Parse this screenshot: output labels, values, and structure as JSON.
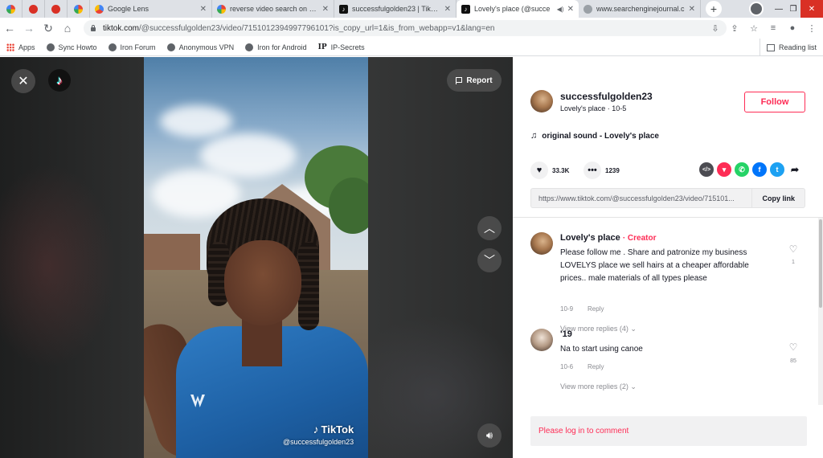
{
  "browser": {
    "tabs": [
      {
        "title": "",
        "icon": "google-icon"
      },
      {
        "title": "",
        "icon": "red-circle-icon"
      },
      {
        "title": "",
        "icon": "red-circle-icon"
      },
      {
        "title": "",
        "icon": "google-icon"
      },
      {
        "title": "Google Lens",
        "icon": "google-lens-icon"
      },
      {
        "title": "reverse video search on goo",
        "icon": "google-icon"
      },
      {
        "title": "successfulgolden23 | TikTok",
        "icon": "tiktok-icon"
      },
      {
        "title": "Lovely's place (@succe",
        "icon": "tiktok-icon",
        "active": true
      },
      {
        "title": "www.searchenginejournal.c",
        "icon": "globe-icon"
      }
    ],
    "url_host": "tiktok.com",
    "url_path": "/@successfulgolden23/video/7151012394997796101?is_copy_url=1&is_from_webapp=v1&lang=en",
    "bookmarks": [
      "Apps",
      "Sync Howto",
      "Iron Forum",
      "Anonymous VPN",
      "Iron for Android",
      "IP-Secrets"
    ],
    "reading_list": "Reading list"
  },
  "video": {
    "report_label": "Report",
    "watermark_brand": "TikTok",
    "watermark_user": "@successfulgolden23"
  },
  "post": {
    "author_name": "successfulgolden23",
    "author_sub": "Lovely's place · 10-5",
    "follow_label": "Follow",
    "sound": "original sound - Lovely's place",
    "likes": "33.3K",
    "comments": "1239",
    "link": "https://www.tiktok.com/@successfulgolden23/video/715101...",
    "copy_label": "Copy link"
  },
  "comments": [
    {
      "name": "Lovely's place",
      "badge": "· Creator",
      "text": "Please follow me . Share and patronize my business LOVELYS place we sell hairs at a cheaper affordable prices.. male materials of all types please",
      "date": "10-9",
      "reply": "Reply",
      "likes": "1",
      "more_replies": "View more replies (4)"
    },
    {
      "name": "'19",
      "badge": "",
      "text": "Na to start using canoe",
      "date": "10-6",
      "reply": "Reply",
      "likes": "85",
      "more_replies": "View more replies (2)"
    }
  ],
  "login_prompt": "Please log in to comment",
  "colors": {
    "accent": "#fe2c55",
    "text": "#161823",
    "muted": "#8a8b91"
  }
}
